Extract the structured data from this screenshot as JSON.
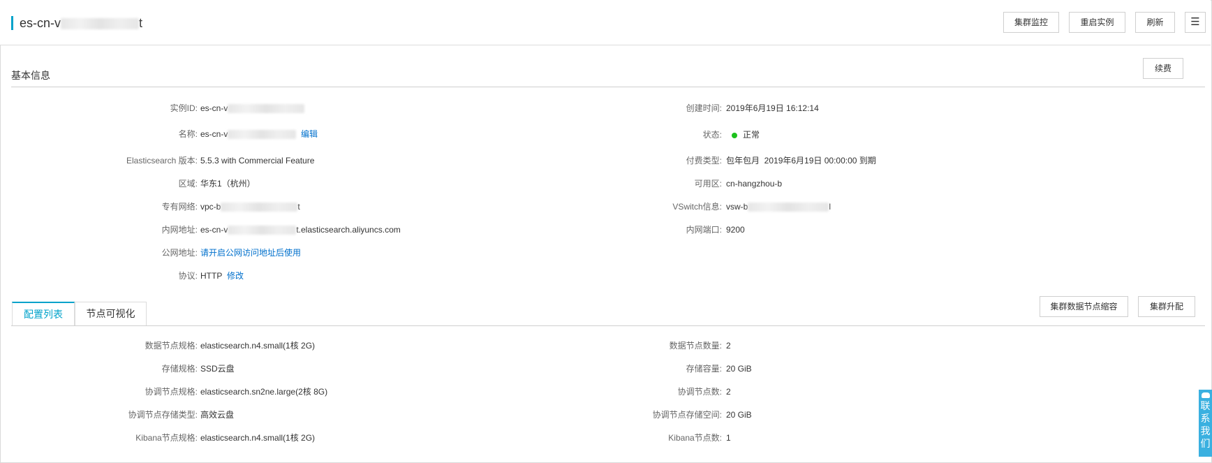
{
  "header": {
    "title_prefix": "es-cn-v",
    "title_suffix": "t",
    "buttons": {
      "monitor": "集群监控",
      "restart": "重启实例",
      "refresh": "刷新",
      "menu": "☰"
    }
  },
  "basic": {
    "section_title": "基本信息",
    "renew_button": "续费",
    "left": {
      "instance_id": {
        "label": "实例ID:",
        "value": "es-cn-v"
      },
      "name": {
        "label": "名称:",
        "value": "es-cn-v",
        "edit": "编辑"
      },
      "version": {
        "label": "Elasticsearch 版本:",
        "value": "5.5.3 with Commercial Feature"
      },
      "region": {
        "label": "区域:",
        "value": "华东1（杭州）"
      },
      "vpc": {
        "label": "专有网络:",
        "value_prefix": "vpc-b",
        "value_suffix": "t"
      },
      "intranet_addr": {
        "label": "内网地址:",
        "value_prefix": "es-cn-v",
        "value_suffix": "t.elasticsearch.aliyuncs.com"
      },
      "public_addr": {
        "label": "公网地址:",
        "link": "请开启公网访问地址后使用"
      },
      "protocol": {
        "label": "协议:",
        "value": "HTTP",
        "edit": "修改"
      }
    },
    "right": {
      "created": {
        "label": "创建时间:",
        "value": "2019年6月19日 16:12:14"
      },
      "status": {
        "label": "状态:",
        "value": "正常",
        "color": "#1dc11d"
      },
      "pay_type": {
        "label": "付费类型:",
        "value": "包年包月  2019年6月19日 00:00:00 到期"
      },
      "zone": {
        "label": "可用区:",
        "value": "cn-hangzhou-b"
      },
      "vswitch": {
        "label": "VSwitch信息:",
        "value_prefix": "vsw-b",
        "value_suffix": "l"
      },
      "intranet_port": {
        "label": "内网端口:",
        "value": "9200"
      }
    }
  },
  "config": {
    "tabs": [
      {
        "label": "配置列表",
        "active": true
      },
      {
        "label": "节点可视化",
        "active": false
      }
    ],
    "buttons": {
      "scale_down": "集群数据节点缩容",
      "upgrade": "集群升配"
    },
    "left": [
      {
        "label": "数据节点规格:",
        "value": "elasticsearch.n4.small(1核 2G)"
      },
      {
        "label": "存储规格:",
        "value": "SSD云盘"
      },
      {
        "label": "协调节点规格:",
        "value": "elasticsearch.sn2ne.large(2核 8G)"
      },
      {
        "label": "协调节点存储类型:",
        "value": "高效云盘"
      },
      {
        "label": "Kibana节点规格:",
        "value": "elasticsearch.n4.small(1核 2G)"
      }
    ],
    "right": [
      {
        "label": "数据节点数量:",
        "value": "2"
      },
      {
        "label": "存储容量:",
        "value": "20 GiB"
      },
      {
        "label": "协调节点数:",
        "value": "2"
      },
      {
        "label": "协调节点存储空间:",
        "value": "20 GiB"
      },
      {
        "label": "Kibana节点数:",
        "value": "1"
      }
    ]
  },
  "contact": {
    "chars": [
      "联",
      "系",
      "我",
      "们"
    ]
  },
  "colors": {
    "accent": "#00a2ca",
    "link": "#0070cc",
    "status_ok": "#1dc11d"
  }
}
